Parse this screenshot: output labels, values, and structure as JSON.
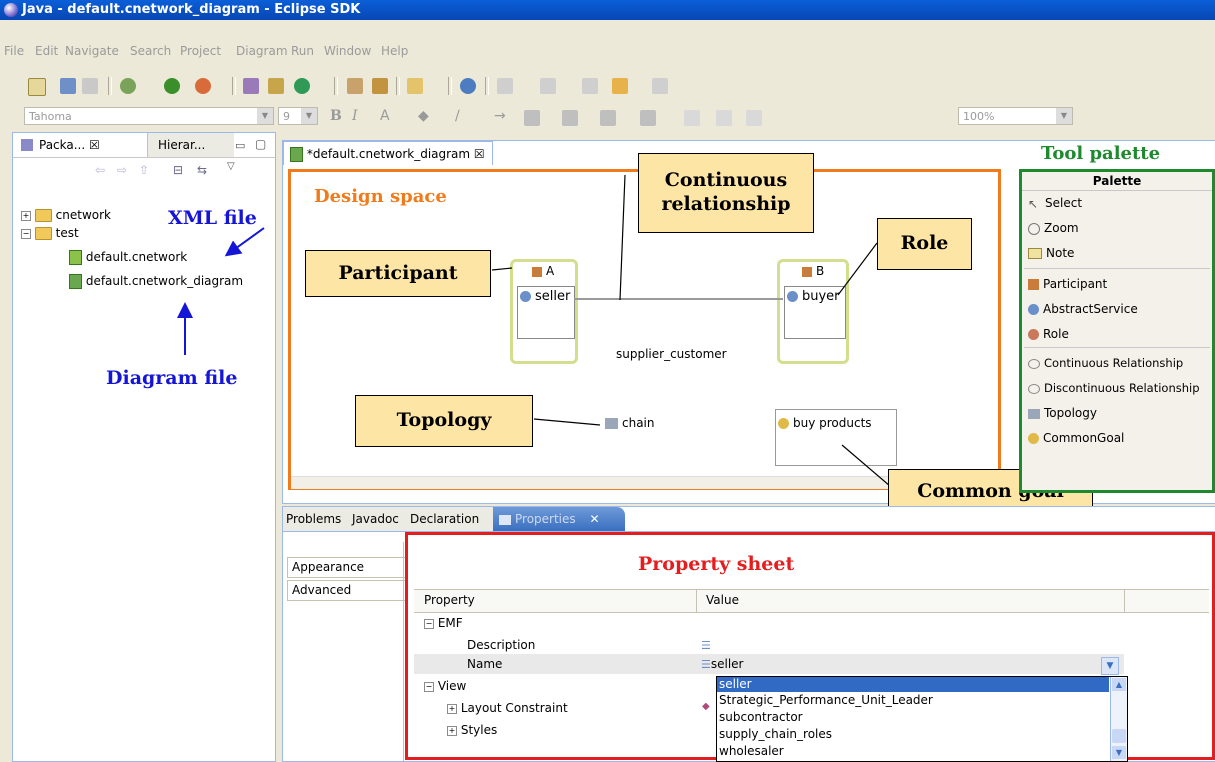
{
  "window": {
    "title": "Java - default.cnetwork_diagram - Eclipse SDK"
  },
  "menu": [
    "File",
    "Edit",
    "Navigate",
    "Search",
    "Project",
    "Diagram",
    "Run",
    "Window",
    "Help"
  ],
  "format_bar": {
    "font": "Tahoma",
    "size": "9",
    "zoom": "100%"
  },
  "left_panel": {
    "tab1": "Packa... ☒",
    "tab2": "Hierar...",
    "tree": [
      {
        "label": "cnetwork"
      },
      {
        "label": "test"
      },
      {
        "label": "default.cnetwork"
      },
      {
        "label": "default.cnetwork_diagram"
      }
    ]
  },
  "editor": {
    "tab": "*default.cnetwork_diagram ☒",
    "participant_a": "A",
    "role_a": "seller",
    "participant_b": "B",
    "role_b": "buyer",
    "relationship": "supplier_customer",
    "topology": "chain",
    "goal": "buy products"
  },
  "palette": {
    "title": "Palette",
    "items": [
      "Select",
      "Zoom",
      "Note",
      "Participant",
      "AbstractService",
      "Role",
      "Continuous Relationship",
      "Discontinuous Relationship",
      "Topology",
      "CommonGoal"
    ]
  },
  "bottom": {
    "tabs": [
      "Problems",
      "Javadoc",
      "Declaration",
      "Properties"
    ],
    "side_tabs": [
      "Appearance",
      "Advanced"
    ],
    "columns": [
      "Property",
      "Value"
    ],
    "rows": {
      "emf": "EMF",
      "description": "Description",
      "name": "Name",
      "name_value": "seller",
      "view": "View",
      "layout": "Layout Constraint",
      "styles": "Styles"
    },
    "dropdown_options": [
      "seller",
      "Strategic_Performance_Unit_Leader",
      "subcontractor",
      "supply_chain_roles",
      "wholesaler"
    ]
  },
  "annotations": {
    "xml_file": "XML file",
    "diagram_file": "Diagram file",
    "design_space": "Design space",
    "tool_palette": "Tool palette",
    "property_sheet": "Property sheet",
    "participant": "Participant",
    "continuous_relationship": "Continuous relationship",
    "role": "Role",
    "topology": "Topology",
    "common_goal": "Common goal"
  },
  "colors": {
    "design_space": "#f07b1d",
    "tool_palette": "#1e8a2e",
    "property_sheet": "#e41e1e",
    "annotation_blue": "#1515d6",
    "callout_fill": "#fde5a5"
  }
}
